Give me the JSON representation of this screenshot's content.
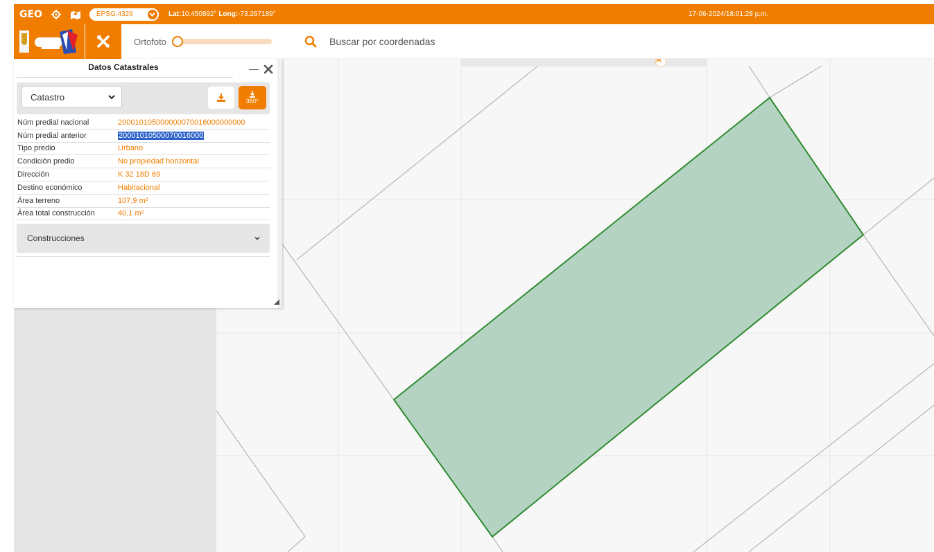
{
  "topbar": {
    "logo": "GEO",
    "epsg": "EPSG:4326",
    "lat_label": "Lat:",
    "lat_value": "10.450892°",
    "long_label": "Long:",
    "long_value": "-73.267189°",
    "datetime": "17-06-2024/18:01:28 p.m.",
    "accent_color": "#f07d00"
  },
  "toolbar": {
    "ortofoto_label": "Ortofoto",
    "ortofoto_opacity": 0
  },
  "search": {
    "placeholder": "Buscar por coordenadas"
  },
  "panel": {
    "title": "Datos Catastrales",
    "layer_select": "Catastro",
    "dl360_label": "360°",
    "rows": [
      {
        "key": "Núm predial nacional",
        "value": "200010105000000070016000000000"
      },
      {
        "key": "Núm predial anterior",
        "value": "20001010500070016000"
      },
      {
        "key": "Tipo predio",
        "value": "Urbano"
      },
      {
        "key": "Condición predio",
        "value": "No propiedad horizontal"
      },
      {
        "key": "Dirección",
        "value": "K 32 18D 69"
      },
      {
        "key": "Destino económico",
        "value": "Habitacional"
      },
      {
        "key": "Área terreno",
        "value": "107,9 m²"
      },
      {
        "key": "Área total construcción",
        "value": "40,1 m²"
      }
    ],
    "accordion_label": "Construcciones"
  },
  "map": {
    "parcel_fill": "#b5d3c3",
    "parcel_stroke": "#2e8b2e"
  }
}
